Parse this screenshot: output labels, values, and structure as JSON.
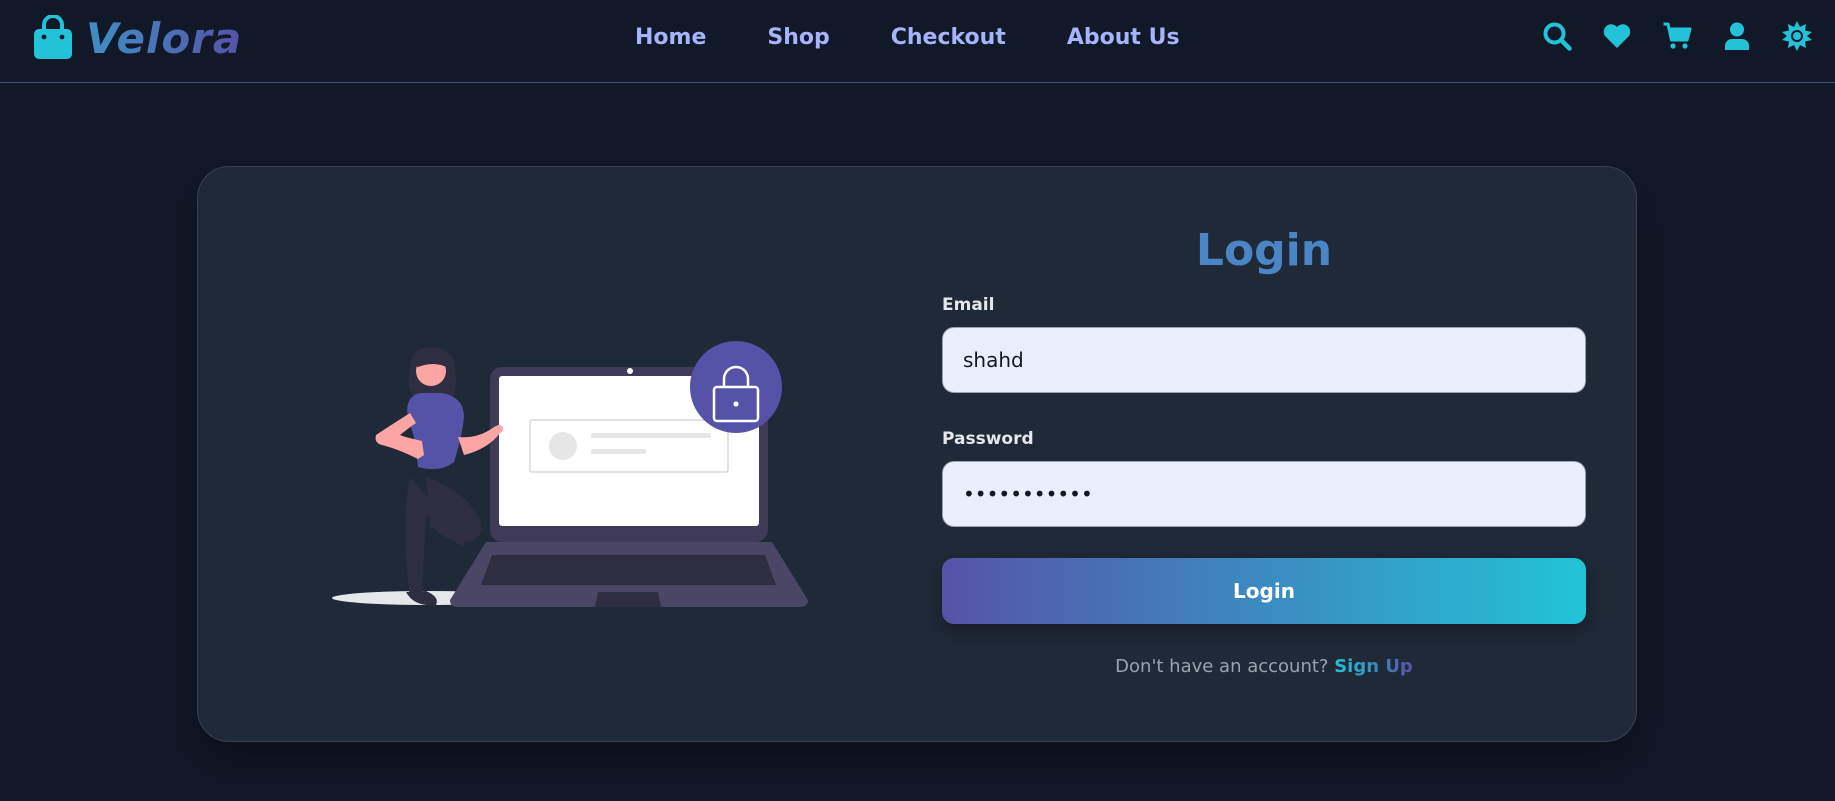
{
  "brand": {
    "name": "Velora",
    "icon": "shopping-bag-icon",
    "accent_color": "#22c3d8",
    "gradient": [
      "#3f8fc4",
      "#5553a8"
    ]
  },
  "nav": {
    "links": [
      {
        "label": "Home"
      },
      {
        "label": "Shop"
      },
      {
        "label": "Checkout"
      },
      {
        "label": "About Us"
      }
    ],
    "icons": [
      "search-icon",
      "heart-icon",
      "cart-icon",
      "user-icon",
      "sun-icon"
    ]
  },
  "login": {
    "title": "Login",
    "email_label": "Email",
    "email_value": "shahd",
    "password_label": "Password",
    "password_value": "•••••••••••",
    "submit_label": "Login",
    "signup_prompt": "Don't have an account?",
    "signup_link": "Sign Up"
  },
  "illustration": {
    "icon": "lock-icon",
    "description_color": "#5553a8"
  }
}
